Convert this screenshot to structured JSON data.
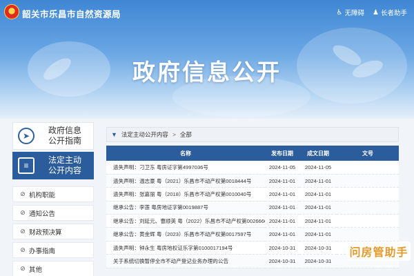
{
  "header": {
    "site_title": "韶关市乐昌市自然资源局",
    "tools": [
      {
        "icon": "accessibility-icon",
        "glyph": "♿",
        "label": "无障碍"
      },
      {
        "icon": "elder-assist-icon",
        "glyph": "♟",
        "label": "长者助手"
      }
    ]
  },
  "hero": {
    "title": "政府信息公开"
  },
  "sidebar": {
    "cards": [
      {
        "icon": "compass-icon",
        "label_line1": "政府信息",
        "label_line2": "公开指南"
      },
      {
        "icon": "document-icon",
        "label_line1": "法定主动",
        "label_line2": "公开内容"
      }
    ],
    "items": [
      {
        "label": "机构职能"
      },
      {
        "label": "通知公告"
      },
      {
        "label": "财政预决算"
      },
      {
        "label": "办事指南"
      },
      {
        "label": "其他"
      }
    ]
  },
  "breadcrumb": {
    "section": "法定主动公开内容",
    "separator": ">",
    "current": "全部"
  },
  "table": {
    "headers": [
      "名称",
      "发布日期",
      "成文日期",
      "文号"
    ],
    "rows": [
      {
        "name": "遗失声明：刁卫东 粤房证字第4997036号",
        "pub": "2024-11-05",
        "doc": "2024-11-05",
        "no": ""
      },
      {
        "name": "遗失声明：温志豪 粤（2021）乐昌市不动产权第0018444号",
        "pub": "2024-11-01",
        "doc": "2024-11-01",
        "no": ""
      },
      {
        "name": "遗失声明：张嘉丽 粤（2018）乐昌市不动产权第0010040号",
        "pub": "2024-11-01",
        "doc": "2024-11-01",
        "no": ""
      },
      {
        "name": "继承公告：李莲 粤房地证字第0019887号",
        "pub": "2024-11-01",
        "doc": "2024-11-01",
        "no": ""
      },
      {
        "name": "继承公告：刘延元、曹顺英 粤（2022）乐昌市不动产权第0026660号",
        "pub": "2024-11-01",
        "doc": "2024-11-01",
        "no": ""
      },
      {
        "name": "继承公告：黄金辉 粤（2023）乐昌市不动产权第0017597号",
        "pub": "2024-11-01",
        "doc": "2024-11-01",
        "no": ""
      },
      {
        "name": "遗失声明：钟永生 粤房地权证乐字第0100017194号",
        "pub": "2024-10-31",
        "doc": "2024-10-31",
        "no": ""
      },
      {
        "name": "关于系统切换暂停全市不动产登记业务办理的公告",
        "pub": "2024-10-31",
        "doc": "2024-10-31",
        "no": ""
      }
    ]
  },
  "watermark": {
    "text": "问房管助手"
  }
}
